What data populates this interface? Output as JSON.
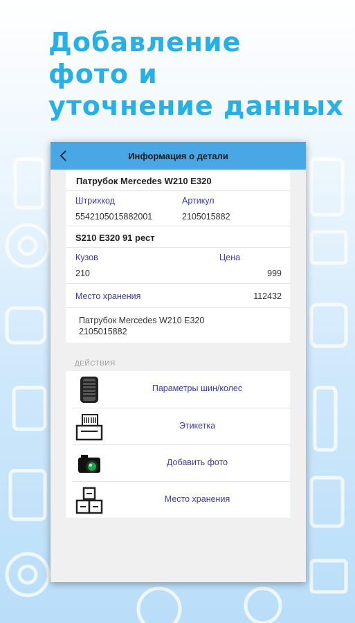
{
  "headline": [
    "Добавление",
    "фото и",
    "уточнение данных"
  ],
  "appbar": {
    "title": "Информация о детали",
    "back_icon": "chevron-left-icon"
  },
  "part": {
    "name": "Патрубок Mercedes W210 E320",
    "barcode_label": "Штрихкод",
    "barcode_value": "5542105015882001",
    "article_label": "Артикул",
    "article_value": "2105015882",
    "model": "S210 E320 91 рест",
    "body_label": "Кузов",
    "body_value": "210",
    "price_label": "Цена",
    "price_value": "999",
    "storage_label": "Место хранения",
    "storage_value": "112432",
    "description_line1": "Патрубок Mercedes W210 E320",
    "description_line2": "2105015882"
  },
  "actions_header": "ДЕЙСТВИЯ",
  "actions": [
    {
      "label": "Параметры шин/колес",
      "icon": "tire-icon"
    },
    {
      "label": "Этикетка",
      "icon": "label-printer-icon"
    },
    {
      "label": "Добавить фото",
      "icon": "camera-icon"
    },
    {
      "label": "Место хранения",
      "icon": "storage-boxes-icon"
    }
  ],
  "colors": {
    "headline": "#25b1e8",
    "appbar": "#4aa7e6",
    "link": "#3a3ab8"
  }
}
